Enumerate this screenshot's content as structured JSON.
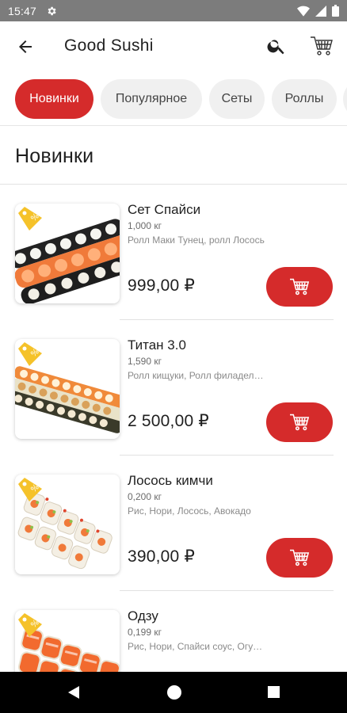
{
  "status_bar": {
    "time": "15:47",
    "icons": [
      "gear-icon",
      "wifi-icon",
      "signal-icon",
      "battery-icon"
    ]
  },
  "app_bar": {
    "title": "Good Sushi",
    "icons": [
      "back-arrow-icon",
      "search-icon",
      "cart-icon"
    ]
  },
  "categories": [
    {
      "label": "Новинки",
      "active": true
    },
    {
      "label": "Популярное",
      "active": false
    },
    {
      "label": "Сеты",
      "active": false
    },
    {
      "label": "Роллы",
      "active": false
    }
  ],
  "section": {
    "title": "Новинки"
  },
  "products": [
    {
      "name": "Сет Спайси",
      "weight": "1,000 кг",
      "description": "Ролл Маки Тунец, ролл Лосось",
      "price": "999,00 ₽"
    },
    {
      "name": "Титан 3.0",
      "weight": "1,590 кг",
      "description": "Ролл кищуки, Ролл филадельфия",
      "price": "2 500,00 ₽"
    },
    {
      "name": "Лосось кимчи",
      "weight": "0,200 кг",
      "description": "Рис, Нори, Лосось, Авокадо",
      "price": "390,00 ₽"
    },
    {
      "name": "Одзу",
      "weight": "0,199 кг",
      "description": "Рис, Нори, Спайси соус, Огурец",
      "price": ""
    }
  ],
  "colors": {
    "accent": "#d52b2b",
    "status_bar": "#7c7c7c",
    "new_tag": "#f5c22a",
    "chip_inactive": "#f0f0f0"
  }
}
